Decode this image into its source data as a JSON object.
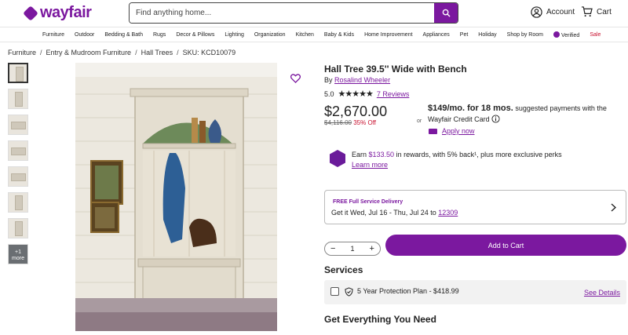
{
  "header": {
    "logo": "wayfair",
    "search_placeholder": "Find anything home...",
    "account_label": "Account",
    "cart_label": "Cart"
  },
  "nav": {
    "items": [
      "Furniture",
      "Outdoor",
      "Bedding & Bath",
      "Rugs",
      "Decor & Pillows",
      "Lighting",
      "Organization",
      "Kitchen",
      "Baby & Kids",
      "Home Improvement",
      "Appliances",
      "Pet",
      "Holiday",
      "Shop by Room",
      "Verified",
      "Sale"
    ]
  },
  "breadcrumb": [
    "Furniture",
    "Entry & Mudroom Furniture",
    "Hall Trees",
    "SKU: KCD10079"
  ],
  "thumbnails": {
    "more_label": "+1 more"
  },
  "product": {
    "title": "Hall Tree 39.5'' Wide with Bench",
    "by_prefix": "By",
    "brand": "Rosalind Wheeler",
    "rating": "5.0",
    "stars": "★★★★★",
    "reviews": "7 Reviews",
    "price": "$2,670.00",
    "was_price": "$4,116.00",
    "discount": "35% Off"
  },
  "finance": {
    "or": "or",
    "monthly": "$149/mo. for 18 mos.",
    "text": "suggested payments with the Wayfair Credit Card",
    "apply": "Apply now"
  },
  "rewards": {
    "prefix": "Earn",
    "amount": "$133.50",
    "suffix": "in rewards, with 5% back¹, plus more exclusive perks",
    "learn": "Learn more"
  },
  "delivery": {
    "title": "FREE Full Service Delivery",
    "date": "Get it Wed, Jul 16 - Thu, Jul 24 to",
    "zip": "12309"
  },
  "purchase": {
    "qty": "1",
    "add_to_cart": "Add to Cart"
  },
  "services": {
    "heading": "Services",
    "plan": "5 Year Protection Plan - $418.99",
    "see_details": "See Details"
  },
  "everything": {
    "heading": "Get Everything You Need"
  },
  "colors": {
    "brand": "#7b189f",
    "sale": "#c8102e"
  }
}
